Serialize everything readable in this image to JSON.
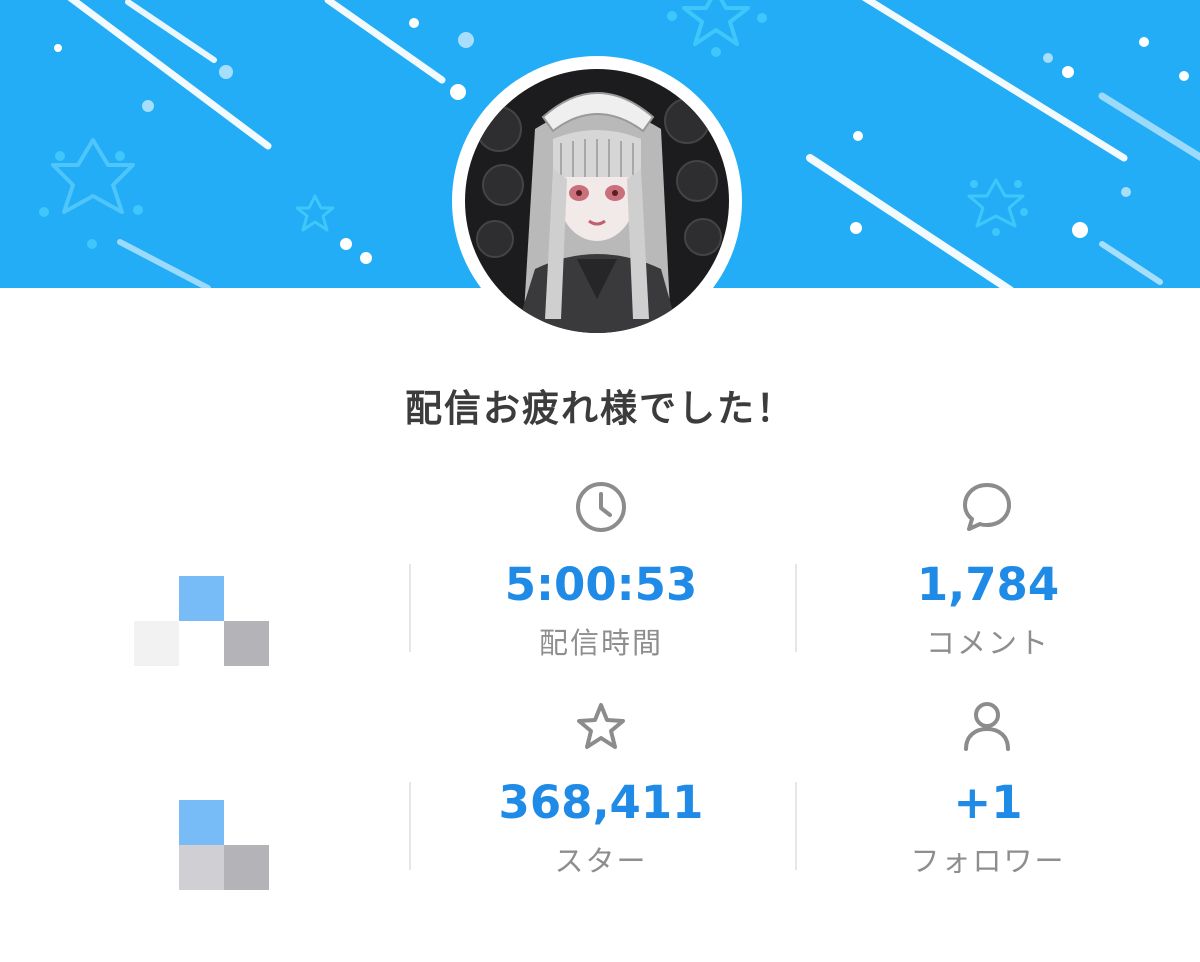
{
  "header": {
    "banner_color": "#22adf6",
    "decoration": "stars-and-streaks"
  },
  "avatar": {
    "icon": "anime-maid-character-avatar"
  },
  "title": "配信お疲れ様でした！",
  "stats": [
    {
      "value": "5:00:53",
      "label": "配信時間",
      "icon": "clock-icon"
    },
    {
      "value": "1,784",
      "label": "コメント",
      "icon": "comment-bubble-icon"
    },
    {
      "value": "368,411",
      "label": "スター",
      "icon": "star-icon"
    },
    {
      "value": "+1",
      "label": "フォロワー",
      "icon": "person-icon"
    }
  ],
  "colors": {
    "value_text": "#1f8be6",
    "label_text": "#8e8e8e",
    "title_text": "#3c3c3c",
    "icon_gray": "#8c8c8c"
  },
  "mosaic_blocks": [
    {
      "cells": [
        "#78bcf7",
        "#f2f2f2",
        "#b4b4b8"
      ]
    },
    {
      "cells": [
        "#78bcf7",
        "#d0d0d4",
        "#b4b4b8"
      ]
    }
  ]
}
